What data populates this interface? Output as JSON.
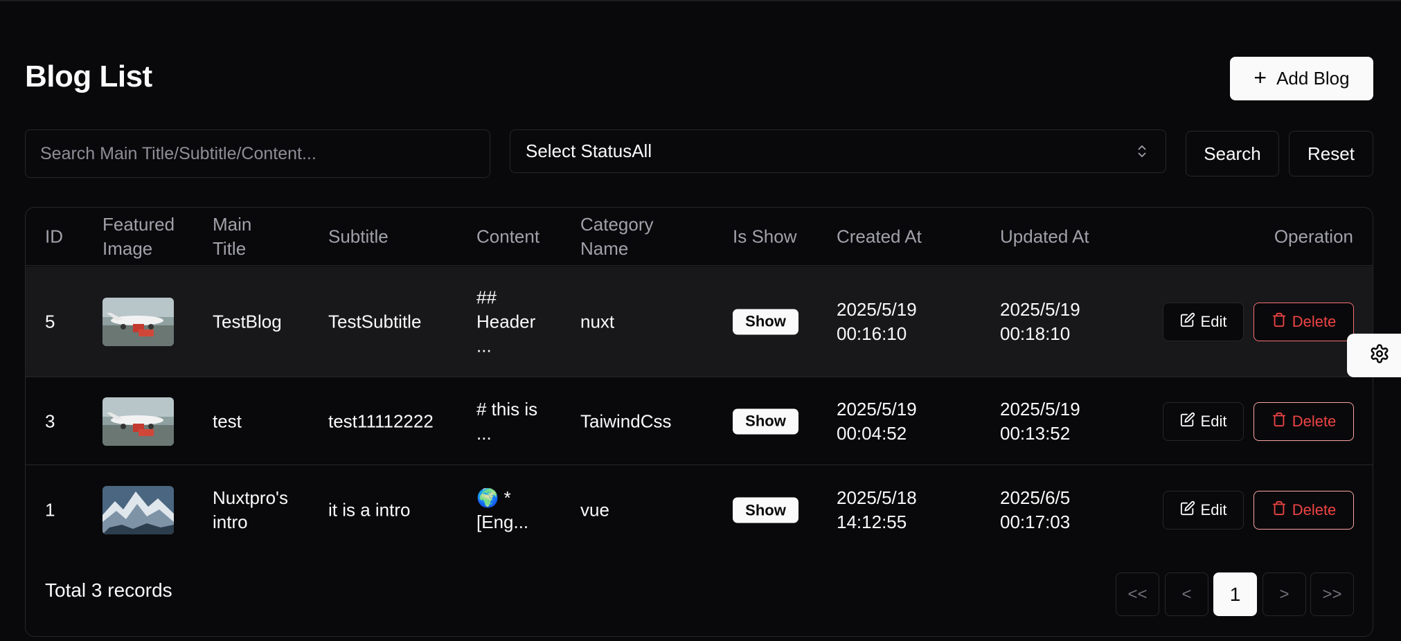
{
  "page": {
    "title": "Blog List",
    "add_button_label": "Add Blog"
  },
  "filters": {
    "search_placeholder": "Search Main Title/Subtitle/Content...",
    "search_value": "",
    "status_label": "Select StatusAll",
    "search_button_label": "Search",
    "reset_button_label": "Reset"
  },
  "table": {
    "headers": {
      "id": "ID",
      "image_line1": "Featured",
      "image_line2": "Image",
      "title_line1": "Main",
      "title_line2": "Title",
      "subtitle": "Subtitle",
      "content": "Content",
      "category_line1": "Category",
      "category_line2": "Name",
      "is_show": "Is Show",
      "created_at": "Created At",
      "updated_at": "Updated At",
      "operation": "Operation"
    },
    "rows": [
      {
        "id": "5",
        "image": "airplane-thumbnail",
        "title_line1": "TestBlog",
        "title_line2": "",
        "subtitle": "TestSubtitle",
        "content_line1": "##",
        "content_line2": "Header",
        "content_line3": "...",
        "category": "nuxt",
        "is_show": "Show",
        "created_date": "2025/5/19",
        "created_time": "00:16:10",
        "updated_date": "2025/5/19",
        "updated_time": "00:18:10",
        "edit_label": "Edit",
        "delete_label": "Delete"
      },
      {
        "id": "3",
        "image": "airplane-thumbnail",
        "title_line1": "test",
        "title_line2": "",
        "subtitle": "test11112222",
        "content_line1": "# this is",
        "content_line2": "...",
        "content_line3": "",
        "category": "TaiwindCss",
        "is_show": "Show",
        "created_date": "2025/5/19",
        "created_time": "00:04:52",
        "updated_date": "2025/5/19",
        "updated_time": "00:13:52",
        "edit_label": "Edit",
        "delete_label": "Delete"
      },
      {
        "id": "1",
        "image": "mountain-thumbnail",
        "title_line1": "Nuxtpro's",
        "title_line2": "intro",
        "subtitle": "it is a intro",
        "content_line1": "🌍 *",
        "content_line2": "[Eng...",
        "content_line3": "",
        "category": "vue",
        "is_show": "Show",
        "created_date": "2025/5/18",
        "created_time": "14:12:55",
        "updated_date": "2025/6/5",
        "updated_time": "00:17:03",
        "edit_label": "Edit",
        "delete_label": "Delete"
      }
    ]
  },
  "footer": {
    "total_label": "Total 3 records",
    "first_page": "<<",
    "prev_page": "<",
    "current_page": "1",
    "next_page": ">",
    "last_page": ">>"
  },
  "colors": {
    "background": "#09090b",
    "border": "#27272a",
    "danger": "#ef4444",
    "primary": "#fafafa"
  }
}
